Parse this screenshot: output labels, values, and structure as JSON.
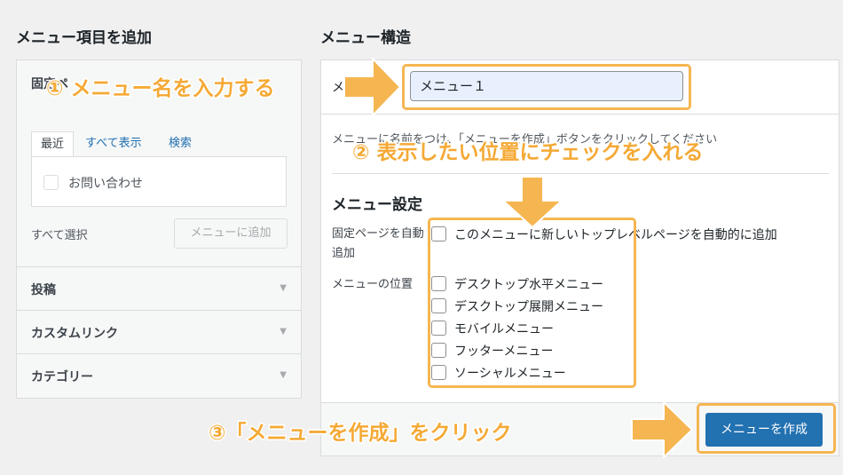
{
  "left": {
    "heading": "メニュー項目を追加",
    "fixed_pages_label": "固定ペ",
    "tabs": [
      "最近",
      "すべて表示",
      "検索"
    ],
    "items": [
      "お問い合わせ"
    ],
    "select_all": "すべて選択",
    "add_button": "メニューに追加",
    "accordion": [
      "投稿",
      "カスタムリンク",
      "カテゴリー"
    ]
  },
  "right": {
    "heading": "メニュー構造",
    "name_label": "メ",
    "name_value": "メニュー１",
    "instruction": "メニューに名前をつけ、「メニューを作成」ボタンをクリックしてください",
    "settings_heading": "メニュー設定",
    "auto_add_label": "固定ページを自動追加",
    "auto_add_option": "このメニューに新しいトップレベルページを自動的に追加",
    "location_label": "メニューの位置",
    "locations": [
      "デスクトップ水平メニュー",
      "デスクトップ展開メニュー",
      "モバイルメニュー",
      "フッターメニュー",
      "ソーシャルメニュー"
    ],
    "create_button": "メニューを作成"
  },
  "annotations": {
    "step1": "① メニュー名を入力する",
    "step2": "② 表示したい位置にチェックを入れる",
    "step3": "③「メニューを作成」をクリック"
  },
  "colors": {
    "accent": "#2271b1",
    "annotation": "#f5b651"
  }
}
